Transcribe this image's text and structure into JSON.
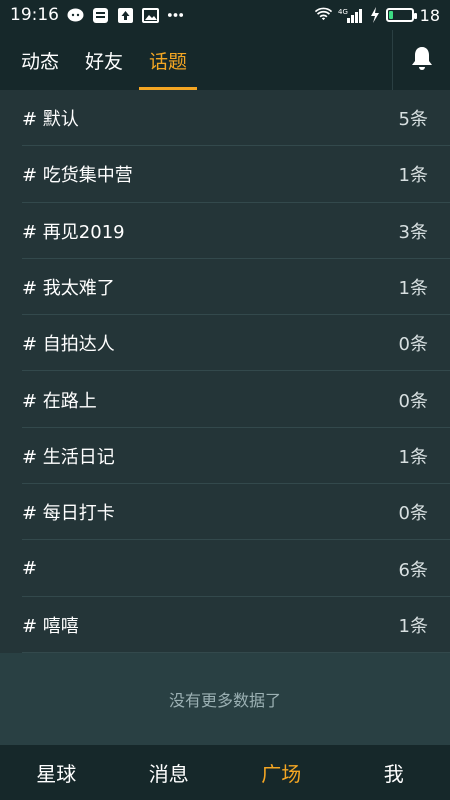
{
  "status_bar": {
    "time": "19:16",
    "network": "4G",
    "battery_text": "18",
    "battery_level": 0.18
  },
  "tabs": [
    {
      "label": "动态",
      "active": false
    },
    {
      "label": "好友",
      "active": false
    },
    {
      "label": "话题",
      "active": true
    }
  ],
  "topics": [
    {
      "name": "# 默认",
      "count": "5条"
    },
    {
      "name": "# 吃货集中营",
      "count": "1条"
    },
    {
      "name": "# 再见2019",
      "count": "3条"
    },
    {
      "name": "# 我太难了",
      "count": "1条"
    },
    {
      "name": "# 自拍达人",
      "count": "0条"
    },
    {
      "name": "# 在路上",
      "count": "0条"
    },
    {
      "name": "# 生活日记",
      "count": "1条"
    },
    {
      "name": "# 每日打卡",
      "count": "0条"
    },
    {
      "name": "#",
      "count": "6条"
    },
    {
      "name": "# 嘻嘻",
      "count": "1条"
    }
  ],
  "footer_text": "没有更多数据了",
  "bottom_nav": [
    {
      "label": "星球",
      "active": false
    },
    {
      "label": "消息",
      "active": false
    },
    {
      "label": "广场",
      "active": true
    },
    {
      "label": "我",
      "active": false
    }
  ],
  "colors": {
    "accent": "#f4a623",
    "background": "#1f2e31",
    "header": "#16282a"
  }
}
